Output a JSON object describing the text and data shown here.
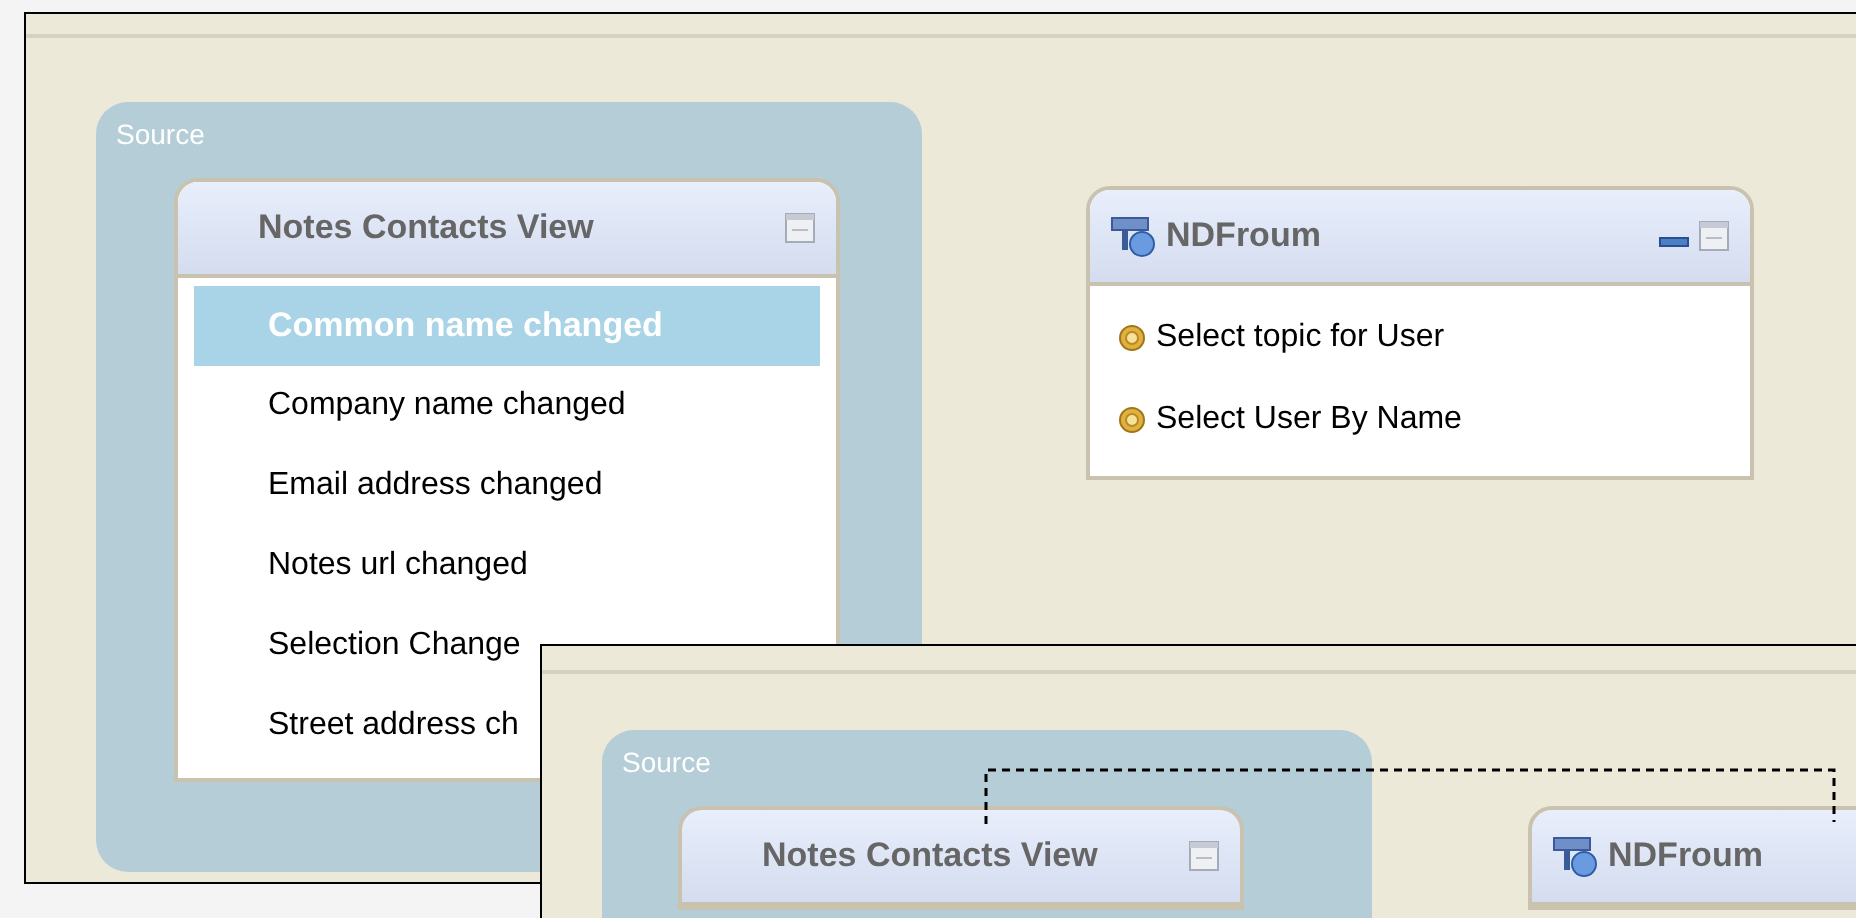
{
  "views": [
    {
      "source_group": {
        "label": "Source",
        "card": {
          "title": "Notes Contacts View",
          "controls": [
            {
              "kind": "restore"
            }
          ],
          "items": [
            {
              "label": "Common name changed",
              "selected": true
            },
            {
              "label": "Company name changed",
              "selected": false
            },
            {
              "label": "Email address changed",
              "selected": false
            },
            {
              "label": "Notes url changed",
              "selected": false
            },
            {
              "label": "Selection Change",
              "selected": false
            },
            {
              "label": "Street address ch",
              "selected": false
            }
          ]
        }
      },
      "component_card": {
        "title": "NDFroum",
        "controls": [
          {
            "kind": "minimize"
          },
          {
            "kind": "restore"
          }
        ],
        "items": [
          {
            "label": "Select topic for User"
          },
          {
            "label": "Select User By Name"
          }
        ]
      }
    },
    {
      "source_group": {
        "label": "Source",
        "card": {
          "title": "Notes Contacts View",
          "controls": [
            {
              "kind": "restore"
            }
          ]
        }
      },
      "component_card": {
        "title": "NDFroum"
      },
      "connector": true
    }
  ]
}
